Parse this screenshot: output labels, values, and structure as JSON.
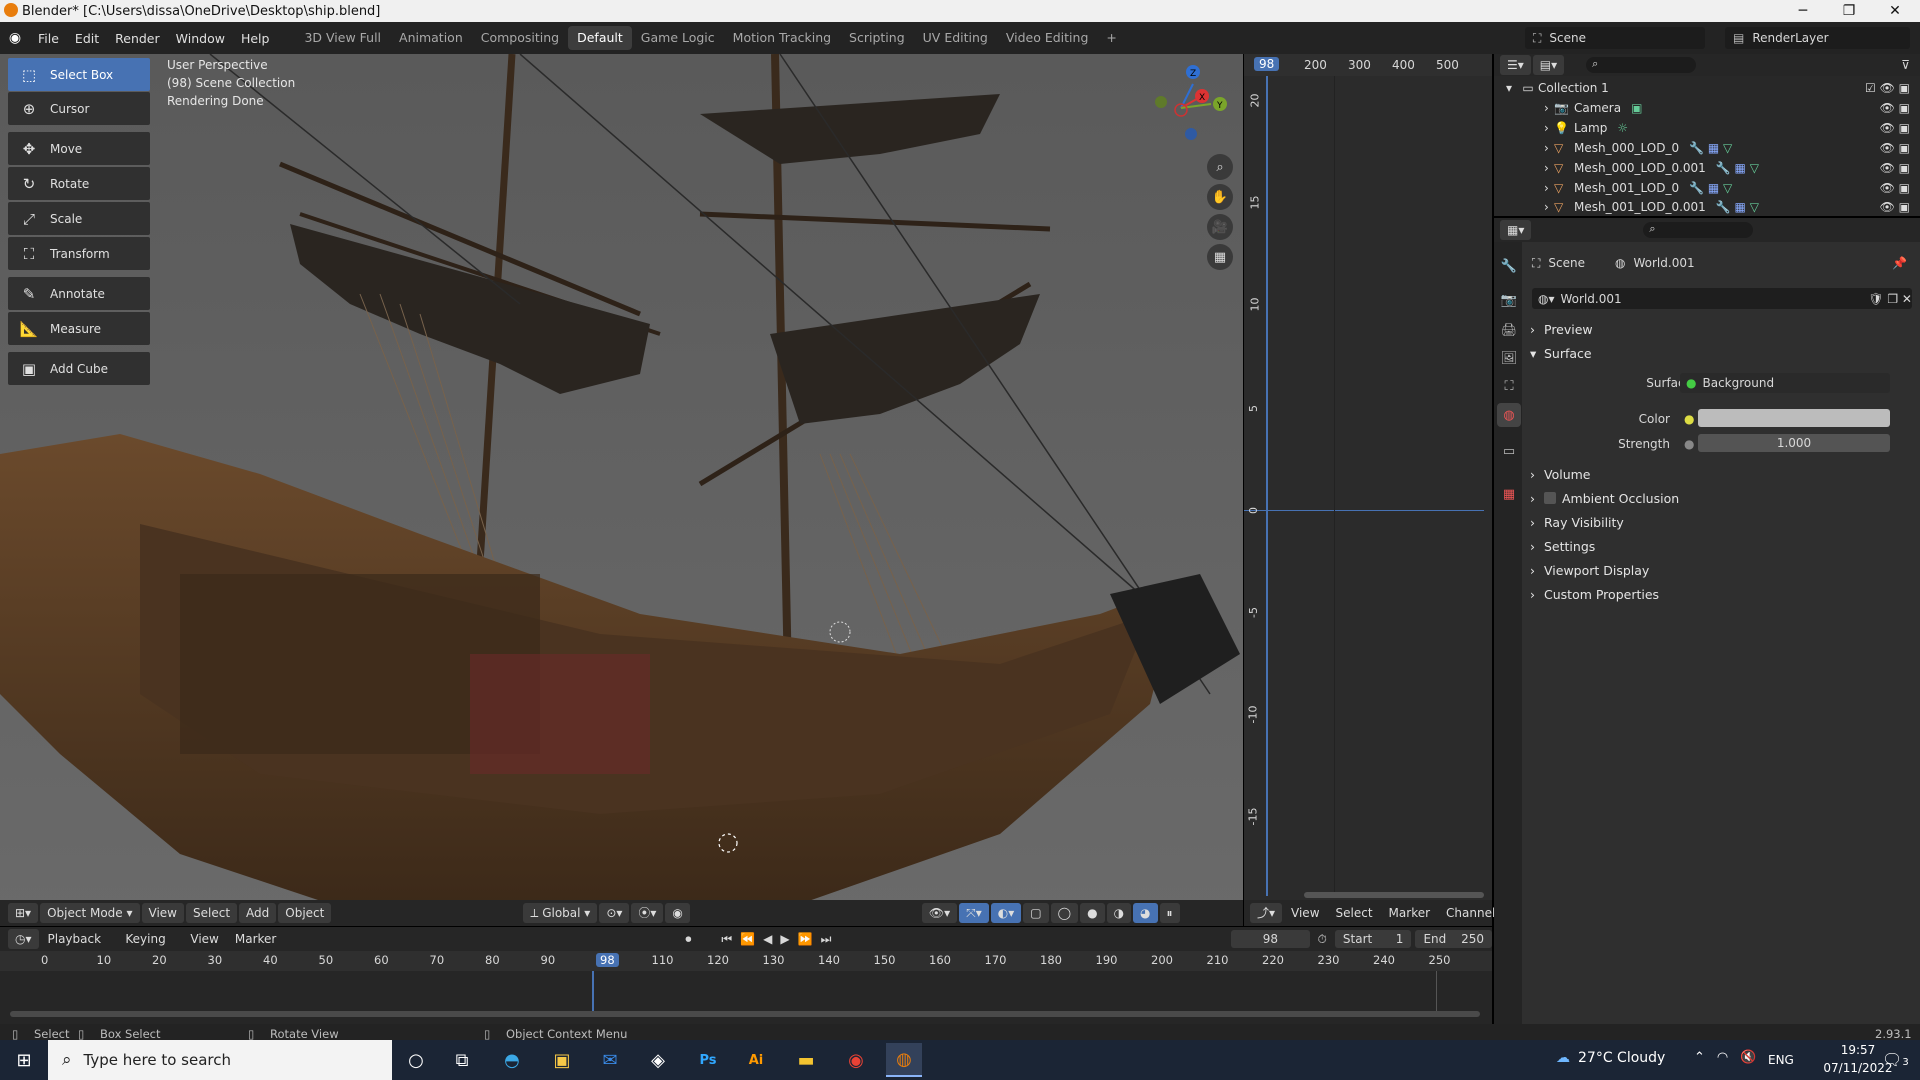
{
  "window": {
    "title": "Blender* [C:\\Users\\dissa\\OneDrive\\Desktop\\ship.blend]"
  },
  "menu": [
    "File",
    "Edit",
    "Render",
    "Window",
    "Help"
  ],
  "workspaces": [
    "3D View Full",
    "Animation",
    "Compositing",
    "Default",
    "Game Logic",
    "Motion Tracking",
    "Scripting",
    "UV Editing",
    "Video Editing"
  ],
  "active_workspace": "Default",
  "scene": {
    "name": "Scene",
    "render_layer": "RenderLayer"
  },
  "tools": [
    "Select Box",
    "Cursor",
    "Move",
    "Rotate",
    "Scale",
    "Transform",
    "Annotate",
    "Measure",
    "Add Cube"
  ],
  "viewport": {
    "perspective": "User Perspective",
    "collection": "(98) Scene Collection",
    "status": "Rendering Done"
  },
  "viewport_header": {
    "mode": "Object Mode",
    "menus": [
      "View",
      "Select",
      "Add",
      "Object"
    ],
    "orientation": "Global"
  },
  "graph": {
    "top_ticks": [
      "98",
      "200",
      "300",
      "400",
      "500"
    ],
    "side_ticks": [
      "20",
      "15",
      "10",
      "5",
      "0",
      "-5",
      "-10",
      "-15"
    ],
    "menus": [
      "View",
      "Select",
      "Marker",
      "Channel"
    ]
  },
  "outliner": {
    "collection": "Collection 1",
    "items": [
      {
        "name": "Camera"
      },
      {
        "name": "Lamp"
      },
      {
        "name": "Mesh_000_LOD_0"
      },
      {
        "name": "Mesh_000_LOD_0.001"
      },
      {
        "name": "Mesh_001_LOD_0"
      },
      {
        "name": "Mesh_001_LOD_0.001"
      }
    ]
  },
  "properties": {
    "breadcrumb_scene": "Scene",
    "breadcrumb_world": "World.001",
    "world_name": "World.001",
    "panels": [
      "Preview",
      "Surface",
      "Volume",
      "Ambient Occlusion",
      "Ray Visibility",
      "Settings",
      "Viewport Display",
      "Custom Properties"
    ],
    "surface_label": "Surface",
    "surface_value": "Background",
    "color_label": "Color",
    "strength_label": "Strength",
    "strength_value": "1.000"
  },
  "timeline": {
    "menus": [
      "Playback",
      "Keying",
      "View",
      "Marker"
    ],
    "current_frame": "98",
    "start_label": "Start",
    "start": "1",
    "end_label": "End",
    "end": "250",
    "ruler": [
      "0",
      "10",
      "20",
      "30",
      "40",
      "50",
      "60",
      "70",
      "80",
      "90",
      "98",
      "110",
      "120",
      "130",
      "140",
      "150",
      "160",
      "170",
      "180",
      "190",
      "200",
      "210",
      "220",
      "230",
      "240",
      "250"
    ]
  },
  "status": {
    "select": "Select",
    "box_select": "Box Select",
    "rotate_view": "Rotate View",
    "context_menu": "Object Context Menu",
    "version": "2.93.1"
  },
  "taskbar": {
    "search_placeholder": "Type here to search",
    "weather": "27°C  Cloudy",
    "lang": "ENG",
    "time": "19:57",
    "date": "07/11/2022",
    "notifications": "3"
  }
}
